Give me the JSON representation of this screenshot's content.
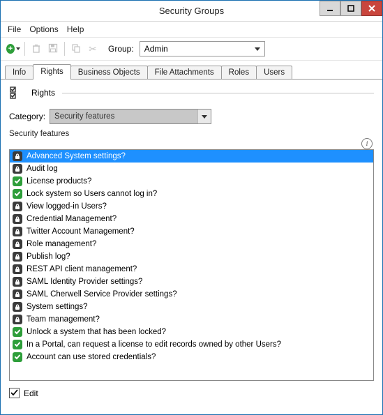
{
  "window": {
    "title": "Security Groups"
  },
  "menu": {
    "file": "File",
    "options": "Options",
    "help": "Help"
  },
  "toolbar": {
    "group_label": "Group:",
    "group_value": "Admin"
  },
  "tabs": {
    "info": "Info",
    "rights": "Rights",
    "business_objects": "Business Objects",
    "file_attachments": "File Attachments",
    "roles": "Roles",
    "users": "Users",
    "active": "rights"
  },
  "section": {
    "title": "Rights"
  },
  "category": {
    "label": "Category:",
    "value": "Security features"
  },
  "list": {
    "label": "Security features",
    "items": [
      {
        "icon": "lock",
        "label": "Advanced System settings?",
        "selected": true
      },
      {
        "icon": "lock",
        "label": "Audit log"
      },
      {
        "icon": "ok",
        "label": "License products?"
      },
      {
        "icon": "ok",
        "label": "Lock system so Users cannot log in?"
      },
      {
        "icon": "lock",
        "label": "View logged-in Users?"
      },
      {
        "icon": "lock",
        "label": "Credential Management?"
      },
      {
        "icon": "lock",
        "label": "Twitter Account Management?"
      },
      {
        "icon": "lock",
        "label": "Role management?"
      },
      {
        "icon": "lock",
        "label": "Publish log?"
      },
      {
        "icon": "lock",
        "label": "REST API client management?"
      },
      {
        "icon": "lock",
        "label": "SAML Identity Provider settings?"
      },
      {
        "icon": "lock",
        "label": "SAML Cherwell Service Provider settings?"
      },
      {
        "icon": "lock",
        "label": "System settings?"
      },
      {
        "icon": "lock",
        "label": "Team management?"
      },
      {
        "icon": "ok",
        "label": "Unlock a system that has been locked?"
      },
      {
        "icon": "ok",
        "label": "In a Portal, can request a license to edit records owned by other Users?"
      },
      {
        "icon": "ok",
        "label": "Account can use stored credentials?"
      }
    ]
  },
  "edit": {
    "label": "Edit",
    "checked": true
  }
}
